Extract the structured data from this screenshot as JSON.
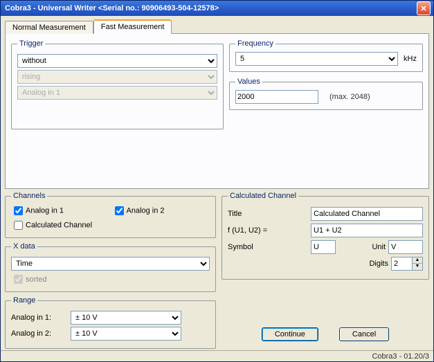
{
  "window": {
    "title": "Cobra3 - Universal Writer  <Serial no.: 90906493-504-12578>"
  },
  "tabs": {
    "normal": "Normal Measurement",
    "fast": "Fast Measurement"
  },
  "trigger": {
    "legend": "Trigger",
    "mode": "without",
    "edge": "rising",
    "source": "Analog in 1"
  },
  "frequency": {
    "legend": "Frequency",
    "value": "5",
    "unit": "kHz"
  },
  "values": {
    "legend": "Values",
    "value": "2000",
    "hint": "(max. 2048)"
  },
  "channels": {
    "legend": "Channels",
    "analog1": "Analog in 1",
    "analog2": "Analog in 2",
    "calc": "Calculated Channel",
    "analog1_checked": true,
    "analog2_checked": true,
    "calc_checked": false
  },
  "xdata": {
    "legend": "X data",
    "value": "Time",
    "sorted_label": "sorted",
    "sorted_checked": true
  },
  "range": {
    "legend": "Range",
    "row1_label": "Analog in 1:",
    "row2_label": "Analog in 2:",
    "row1_value": "± 10 V",
    "row2_value": "± 10 V"
  },
  "calcchan": {
    "legend": "Calculated Channel",
    "title_label": "Title",
    "title_value": "Calculated Channel",
    "formula_label": "f (U1, U2) =",
    "formula_value": "U1 + U2",
    "symbol_label": "Symbol",
    "symbol_value": "U",
    "unit_label": "Unit",
    "unit_value": "V",
    "digits_label": "Digits",
    "digits_value": "2"
  },
  "buttons": {
    "continue": "Continue",
    "cancel": "Cancel"
  },
  "status": "Cobra3 - 01.20/3"
}
